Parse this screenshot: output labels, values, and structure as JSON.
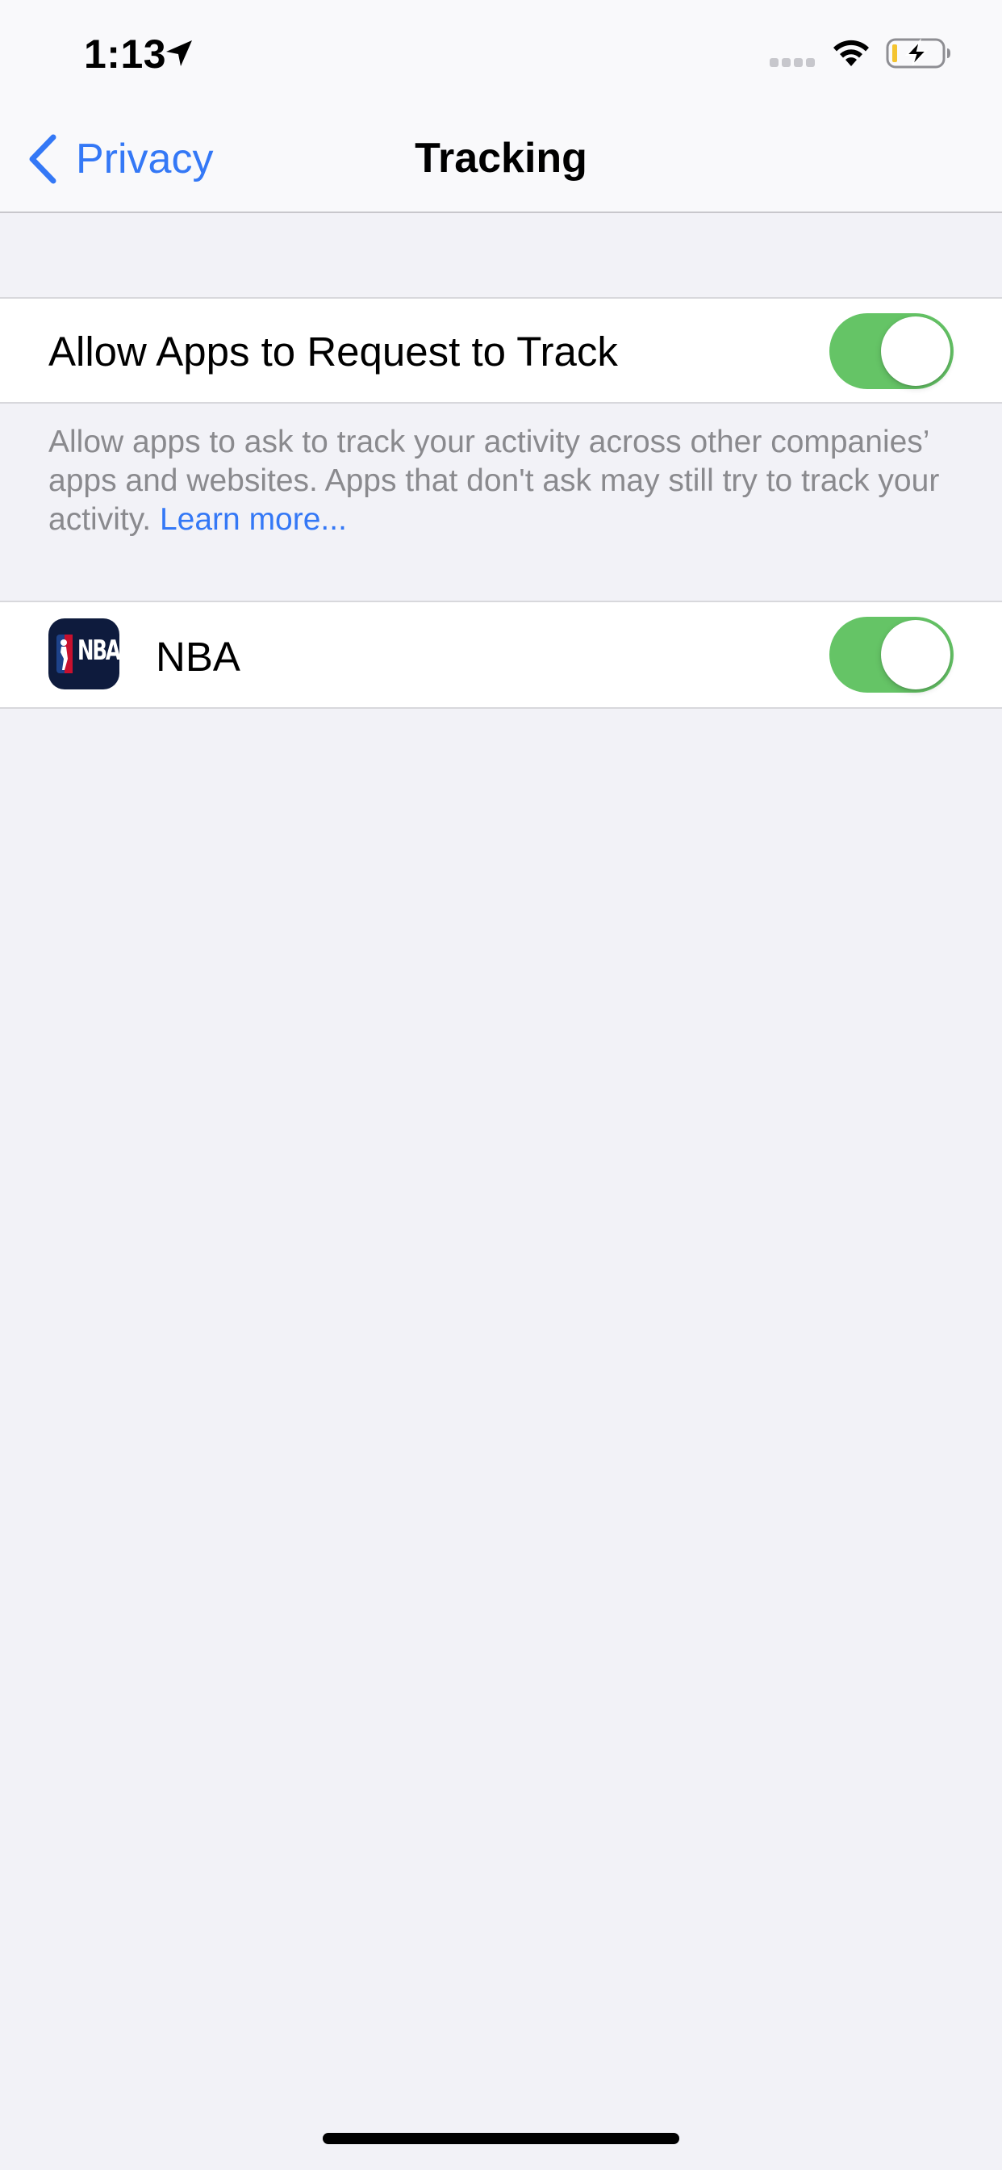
{
  "status_bar": {
    "time": "1:13",
    "icons": [
      "location-arrow-icon",
      "cellular-signal-icon",
      "wifi-icon",
      "battery-charging-icon"
    ]
  },
  "nav": {
    "back_label": "Privacy",
    "title": "Tracking"
  },
  "settings": {
    "allow_tracking": {
      "label": "Allow Apps to Request to Track",
      "enabled": true
    },
    "footer": {
      "text": "Allow apps to ask to track your activity across other companies’ apps and websites. Apps that don't ask may still try to track your activity.",
      "link": "Learn more..."
    },
    "apps": [
      {
        "name": "NBA",
        "icon": "nba-app-icon",
        "icon_text": "NBA",
        "enabled": true
      }
    ]
  },
  "colors": {
    "accent": "#3478f6",
    "toggle_on": "#65c466",
    "background": "#f2f2f7"
  }
}
